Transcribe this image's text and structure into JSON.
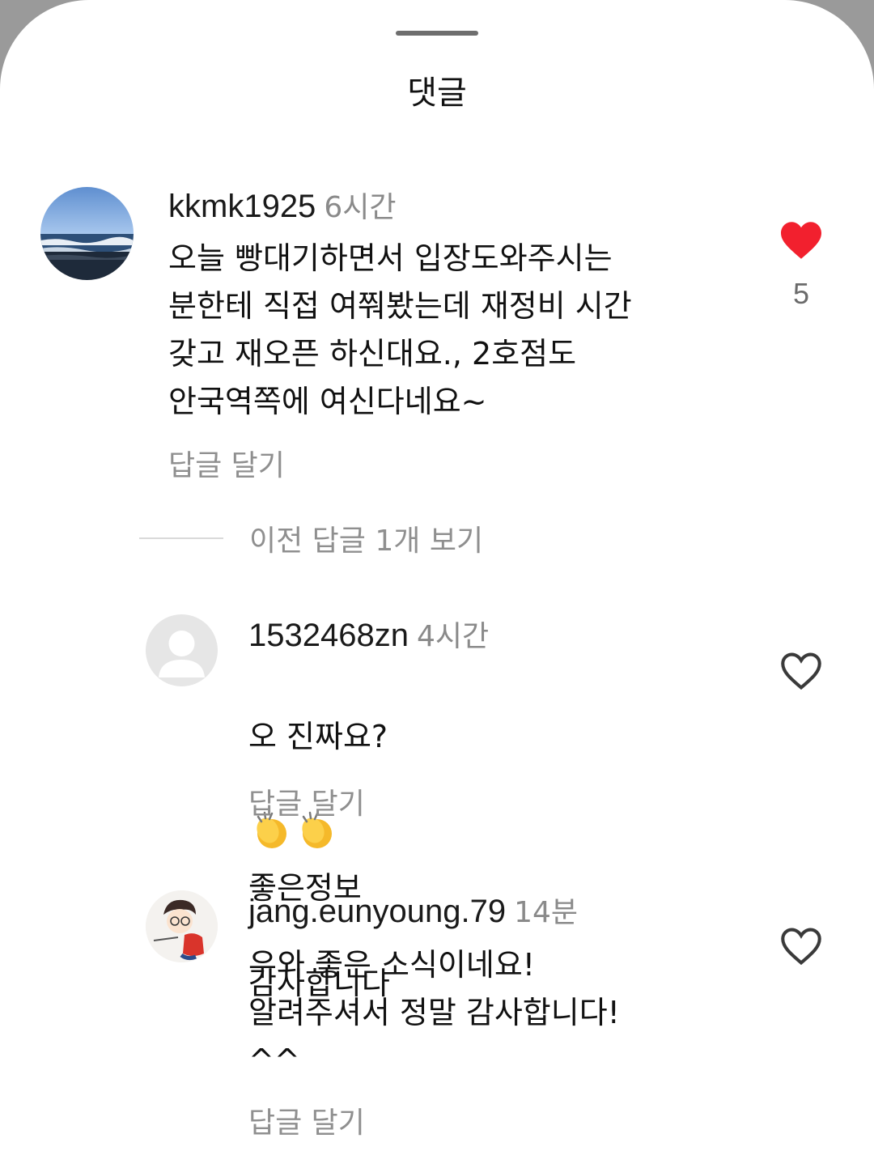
{
  "header": {
    "title": "댓글"
  },
  "comments": [
    {
      "username": "kkmk1925",
      "time": "6시간",
      "text": "오늘 빵대기하면서 입장도와주시는\n분한테 직접 여쭤봤는데 재정비 시간\n갖고 재오픈 하신대요., 2호점도\n안국역쪽에 여신다네요~",
      "reply_label": "답글 달기",
      "likes": "5",
      "liked": true
    },
    {
      "username": "1532468zn",
      "time": "4시간",
      "text_part1": "오 진짜요?",
      "text_part2": "좋은정보",
      "text_line2": "감사합니다",
      "emoji_name": "clapping-hands",
      "reply_label": "답글 달기",
      "liked": false
    },
    {
      "username": "jang.eunyoung.79",
      "time": "14분",
      "text": "우와 좋은 소식이네요!\n알려주셔서 정말 감사합니다!\n^^",
      "reply_label": "답글 달기",
      "liked": false
    }
  ],
  "view_replies": {
    "label": "이전 답글 1개 보기"
  },
  "colors": {
    "heart_filled": "#f2202e",
    "heart_outline": "#3a3a3a",
    "muted_text": "#8f8f8f"
  }
}
